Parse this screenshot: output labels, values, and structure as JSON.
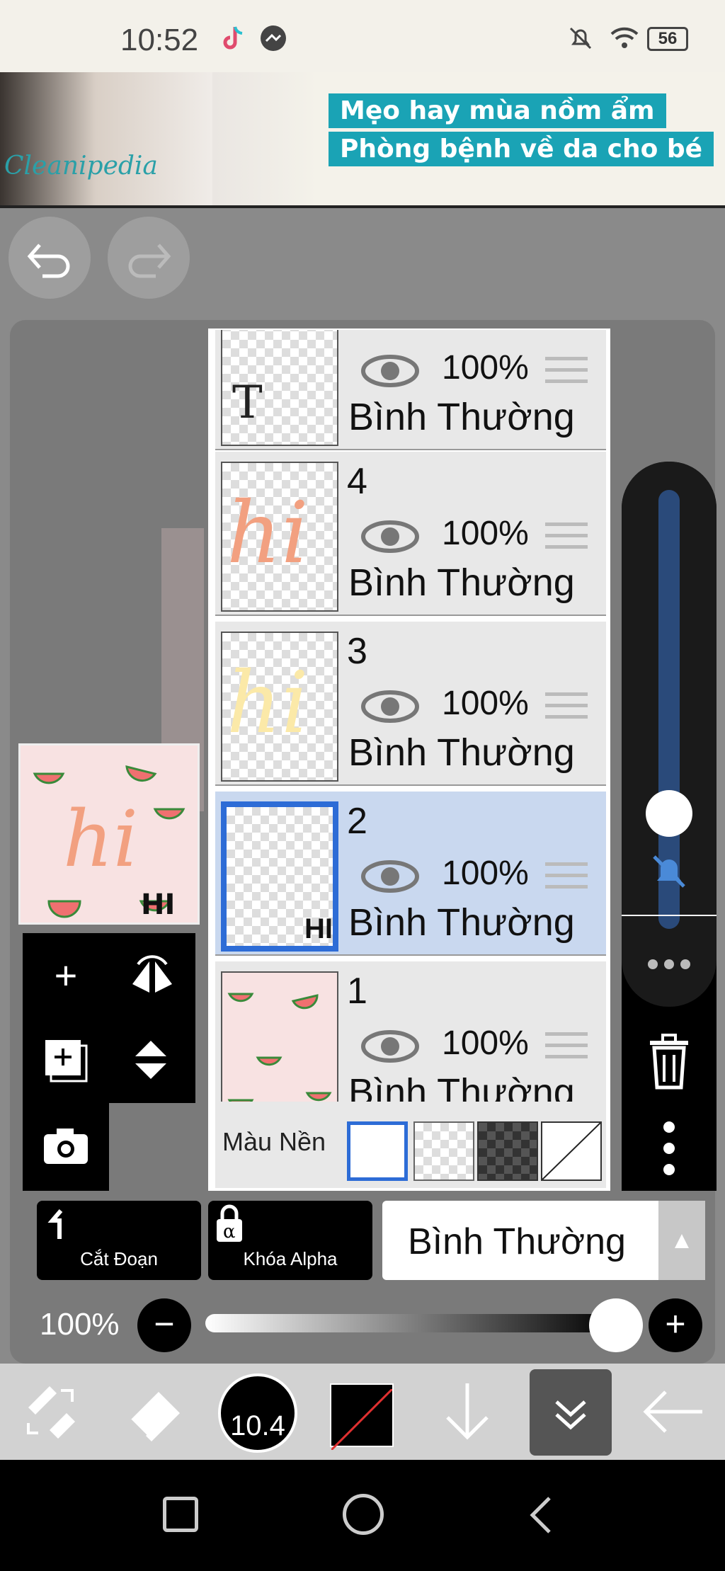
{
  "status_bar": {
    "time": "10:52",
    "battery": "56"
  },
  "ad": {
    "brand": "Cleanipedia",
    "line1": "Mẹo hay mùa nồm ẩm",
    "line2": "Phòng bệnh về da cho bé"
  },
  "layers": [
    {
      "num": "",
      "opacity": "100%",
      "mode": "Bình Thường",
      "thumb_letter": "T"
    },
    {
      "num": "4",
      "opacity": "100%",
      "mode": "Bình Thường",
      "thumb_letter": "hi"
    },
    {
      "num": "3",
      "opacity": "100%",
      "mode": "Bình Thường",
      "thumb_letter": "hi"
    },
    {
      "num": "2",
      "opacity": "100%",
      "mode": "Bình Thường",
      "thumb_letter": "HI"
    },
    {
      "num": "1",
      "opacity": "100%",
      "mode": "Bình Thường",
      "thumb_letter": ""
    }
  ],
  "background_label": "Màu Nền",
  "bottom": {
    "cut_label": "Cắt Đoạn",
    "alpha_label": "Khóa Alpha",
    "blend_mode": "Bình Thường"
  },
  "opacity_value": "100%",
  "brush_size": "10.4",
  "colors": {
    "accent": "#2d6cd6",
    "selected_row": "#c9d8ef"
  }
}
